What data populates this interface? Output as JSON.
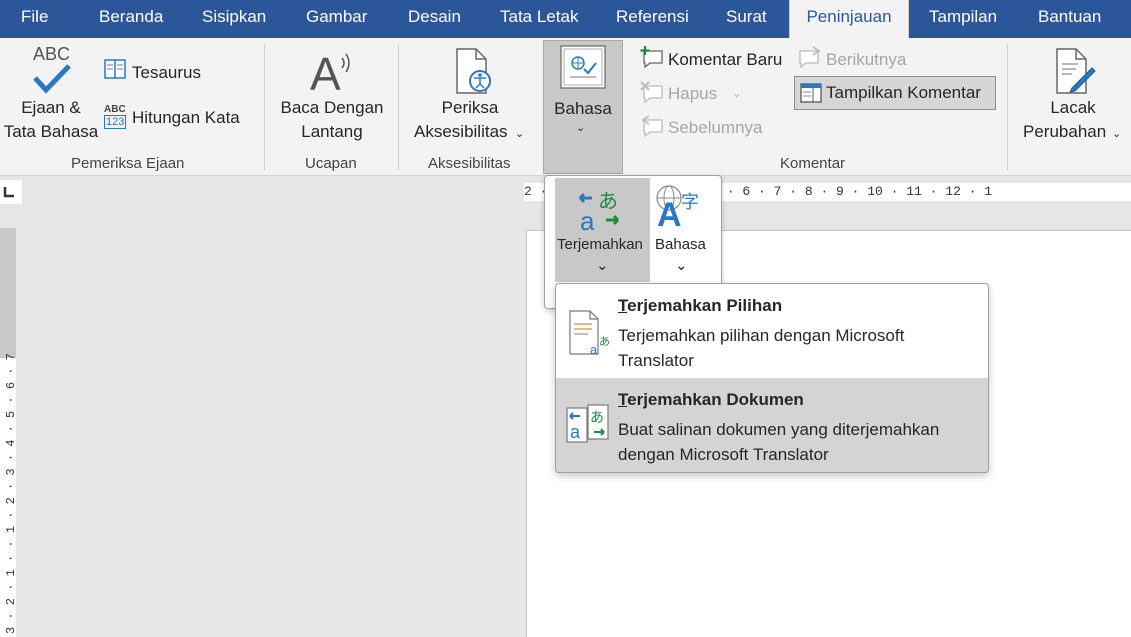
{
  "tabs": [
    "File",
    "Beranda",
    "Sisipkan",
    "Gambar",
    "Desain",
    "Tata Letak",
    "Referensi",
    "Surat",
    "Peninjauan",
    "Tampilan",
    "Bantuan"
  ],
  "active_tab": "Peninjauan",
  "ribbon": {
    "proofing": {
      "spelling_icon_text": "ABC",
      "spelling_line1": "Ejaan &",
      "spelling_line2": "Tata Bahasa",
      "thesaurus": "Tesaurus",
      "wordcount_icon_top": "ABC",
      "wordcount_icon_bottom": "123",
      "word_count": "Hitungan Kata",
      "group_label": "Pemeriksa Ejaan"
    },
    "speech": {
      "read_aloud_line1": "Baca Dengan",
      "read_aloud_line2": "Lantang",
      "group_label": "Ucapan"
    },
    "accessibility": {
      "check_line1": "Periksa",
      "check_line2": "Aksesibilitas",
      "group_label": "Aksesibilitas"
    },
    "language": {
      "label": "Bahasa"
    },
    "comments": {
      "new_comment": "Komentar Baru",
      "delete": "Hapus",
      "previous": "Sebelumnya",
      "next": "Berikutnya",
      "show_comments": "Tampilkan Komentar",
      "group_label": "Komentar"
    },
    "tracking": {
      "track_line1": "Lacak",
      "track_line2": "Perubahan"
    }
  },
  "language_popup": {
    "translate": "Terjemahkan",
    "language": "Bahasa"
  },
  "translate_menu": {
    "items": [
      {
        "title_first_letter": "T",
        "title_rest": "erjemahkan Pilihan",
        "description": "Terjemahkan pilihan dengan Microsoft Translator"
      },
      {
        "title_first_letter": "T",
        "title_rest": "erjemahkan Dokumen",
        "description": "Buat salinan dokumen yang diterjemahkan dengan Microsoft Translator"
      }
    ],
    "hovered_index": 1
  },
  "rulers": {
    "horizontal_text": "2 · 1 · 1 · 2 · 3 · 4 · 5 · 6 · 7 · 8 · 9 · 10 · 11 · 12 · 1",
    "vertical_text": "3 · 2 · 1 · · 1 · 2 · 3 · 4 · 5 · 6 · 7"
  },
  "colors": {
    "tabbar": "#2b579a",
    "ribbon": "#f3f3f3",
    "accent_blue": "#2b78c2",
    "translate_green": "#1e8a3c"
  }
}
